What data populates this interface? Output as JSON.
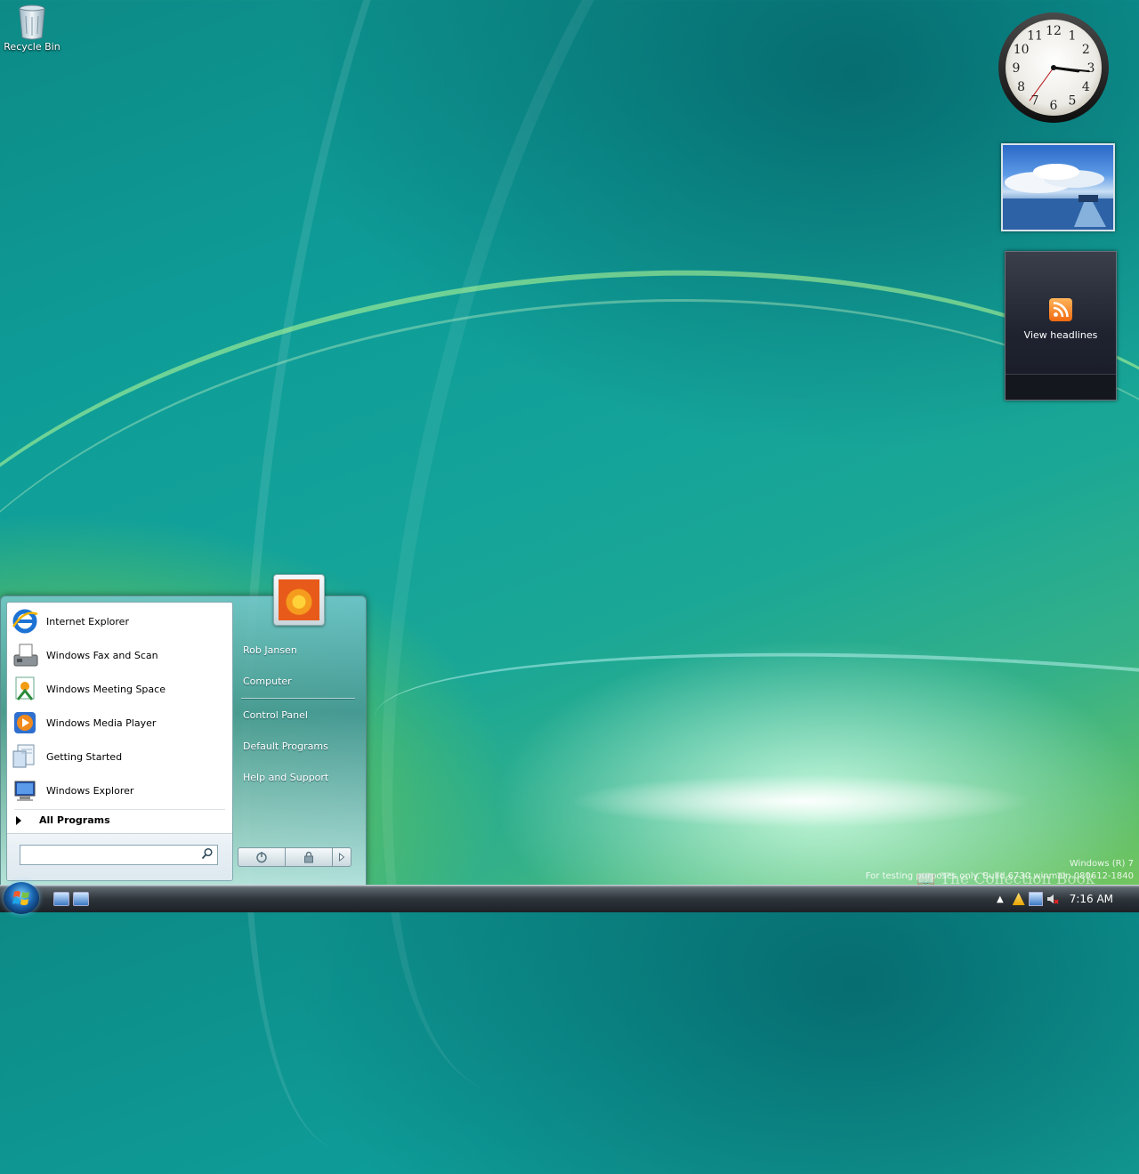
{
  "desktop": {
    "recycle_bin_label": "Recycle Bin",
    "watermark_line1": "Windows (R) 7",
    "watermark_line2": "For testing purposes only. Build 6730.winmain.080612-1840",
    "watermark_brand": "The Collection Book"
  },
  "clock": {
    "numerals": [
      "12",
      "1",
      "2",
      "3",
      "4",
      "5",
      "6",
      "7",
      "8",
      "9",
      "10",
      "11"
    ],
    "hour": 3,
    "minute": 16,
    "second": 36
  },
  "feed": {
    "label": "View headlines"
  },
  "start_menu": {
    "programs": [
      {
        "label": "Internet Explorer",
        "icon": "internet-explorer-icon"
      },
      {
        "label": "Windows Fax and Scan",
        "icon": "fax-scan-icon"
      },
      {
        "label": "Windows Meeting Space",
        "icon": "meeting-space-icon"
      },
      {
        "label": "Windows Media Player",
        "icon": "media-player-icon"
      },
      {
        "label": "Getting Started",
        "icon": "getting-started-icon"
      },
      {
        "label": "Windows Explorer",
        "icon": "windows-explorer-icon"
      }
    ],
    "all_programs": "All Programs",
    "search_placeholder": "",
    "right_items": [
      {
        "label": "Rob Jansen"
      },
      {
        "label": "Computer"
      },
      {
        "label": "Control Panel"
      },
      {
        "label": "Default Programs"
      },
      {
        "label": "Help and Support"
      }
    ]
  },
  "taskbar": {
    "time": "7:16 AM"
  },
  "colors": {
    "accent": "#0e9c98",
    "feed_icon": "#f06a10"
  }
}
